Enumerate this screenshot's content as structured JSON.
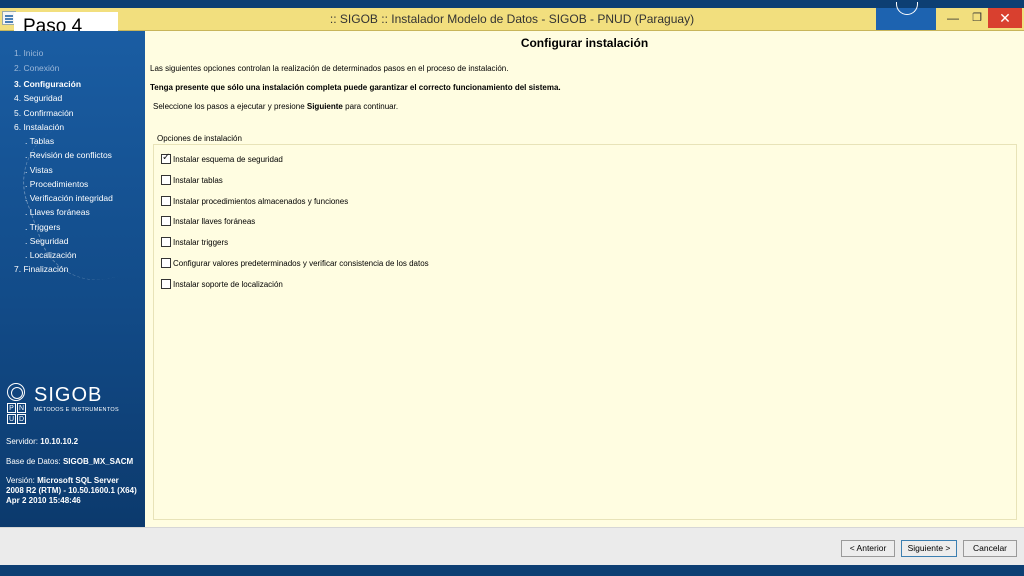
{
  "overlay": {
    "step_label": "Paso 4"
  },
  "window": {
    "title": ":: SIGOB :: Instalador Modelo de Datos - SIGOB - PNUD (Paraguay)",
    "minimize": "—",
    "maximize": "❐",
    "close": "✕"
  },
  "sidebar": {
    "steps": [
      {
        "label": "1. Inicio",
        "state": "done"
      },
      {
        "label": "2. Conexión",
        "state": "done"
      },
      {
        "label": "3. Configuración",
        "state": "current"
      },
      {
        "label": "4. Seguridad",
        "state": "pending"
      },
      {
        "label": "5. Confirmación",
        "state": "pending"
      },
      {
        "label": "6. Instalación",
        "state": "pending"
      },
      {
        "label": ". Tablas",
        "state": "sub"
      },
      {
        "label": ". Revisión de conflictos",
        "state": "sub"
      },
      {
        "label": ". Vistas",
        "state": "sub"
      },
      {
        "label": ". Procedimientos",
        "state": "sub"
      },
      {
        "label": ". Verificación integridad",
        "state": "sub"
      },
      {
        "label": ". Llaves foráneas",
        "state": "sub"
      },
      {
        "label": ". Triggers",
        "state": "sub"
      },
      {
        "label": ". Seguridad",
        "state": "sub"
      },
      {
        "label": ". Localización",
        "state": "sub"
      },
      {
        "label": "7. Finalización",
        "state": "pending"
      }
    ],
    "logo": {
      "name": "SIGOB",
      "subtitle": "MÉTODOS E INSTRUMENTOS",
      "pnud_letters": [
        "P",
        "N",
        "U",
        "D"
      ]
    },
    "server_label": "Servidor:",
    "server_value": "10.10.10.2",
    "db_label": "Base de Datos:",
    "db_value": "SIGOB_MX_SACM",
    "version_label": "Versión:",
    "version_value": "Microsoft SQL Server 2008 R2 (RTM) - 10.50.1600.1 (X64) Apr 2 2010 15:48:46"
  },
  "main": {
    "title": "Configurar instalación",
    "intro": "Las siguientes opciones controlan la realización de determinados pasos en el proceso de instalación.",
    "warning": "Tenga presente que sólo una instalación completa puede garantizar el correcto funcionamiento del sistema.",
    "instruction_before": "Seleccione los pasos a ejecutar y presione ",
    "instruction_bold": "Siguiente",
    "instruction_after": " para continuar.",
    "group_label": "Opciones de instalación",
    "options": [
      {
        "label": "Instalar esquema de seguridad",
        "checked": true
      },
      {
        "label": "Instalar tablas",
        "checked": false
      },
      {
        "label": "Instalar procedimientos almacenados y funciones",
        "checked": false
      },
      {
        "label": "Instalar llaves foráneas",
        "checked": false
      },
      {
        "label": "Instalar triggers",
        "checked": false
      },
      {
        "label": "Configurar valores predeterminados y verificar consistencia de los datos",
        "checked": false
      },
      {
        "label": "Instalar soporte de localización",
        "checked": false
      }
    ]
  },
  "footer": {
    "prev": "< Anterior",
    "next": "Siguiente >",
    "cancel": "Cancelar"
  }
}
